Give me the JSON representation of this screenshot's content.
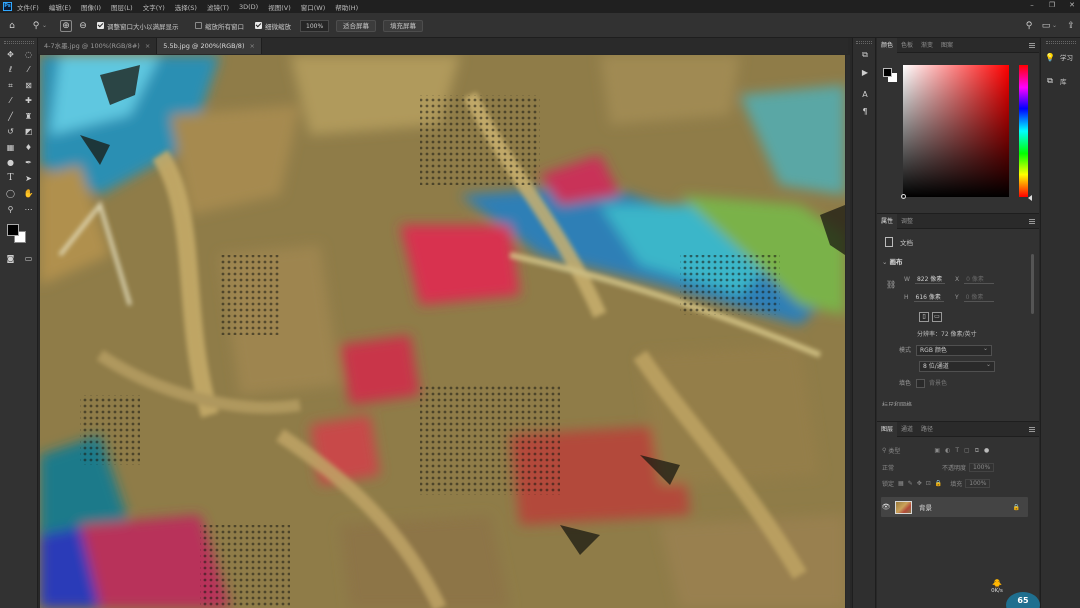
{
  "menubar": {
    "items": [
      "文件(F)",
      "编辑(E)",
      "图像(I)",
      "图层(L)",
      "文字(Y)",
      "选择(S)",
      "滤镜(T)",
      "3D(D)",
      "视图(V)",
      "窗口(W)",
      "帮助(H)"
    ]
  },
  "options": {
    "resize_windows": "调整窗口大小以满屏显示",
    "zoom_all_windows": "缩放所有窗口",
    "scrubby_zoom": "细微缩放",
    "zoom_value": "100%",
    "fit_screen": "适合屏幕",
    "fill_screen": "填充屏幕"
  },
  "tabs": [
    {
      "label": "4-7水墨.jpg @ 100%(RGB/8#)"
    },
    {
      "label": "5.5b.jpg @ 200%(RGB/8)"
    }
  ],
  "color_panel": {
    "tabs": [
      "颜色",
      "色板",
      "渐变",
      "图案"
    ]
  },
  "properties_panel": {
    "tabs": [
      "属性",
      "调整"
    ],
    "doc_label": "文档",
    "canvas_title": "画布",
    "w_label": "W",
    "w_value": "822 像素",
    "x_label": "X",
    "x_value": "0 像素",
    "h_label": "H",
    "h_value": "616 像素",
    "y_label": "Y",
    "y_value": "0 像素",
    "resolution": "分辨率：72 像素/英寸",
    "mode_label": "模式",
    "mode_value": "RGB 颜色",
    "depth_value": "8 位/通道",
    "fill_label": "填色",
    "fill_value": "背景色",
    "next_section": "标尺和网格"
  },
  "layers_panel": {
    "tabs": [
      "图层",
      "通道",
      "路径"
    ],
    "search_placeholder": "类型",
    "blend_mode": "正常",
    "opacity_label": "不透明度",
    "opacity_value": "100%",
    "lock_label": "锁定",
    "fill_label": "填充",
    "fill_value": "100%",
    "layer_name": "背景"
  },
  "right_strip": {
    "learn": "学习",
    "libraries": "库"
  },
  "status": {
    "net_speed": "0K/s",
    "badge": "65"
  },
  "colors": {
    "chrome": "#323232",
    "menubar": "#202020",
    "accent": "#31a8ff"
  }
}
